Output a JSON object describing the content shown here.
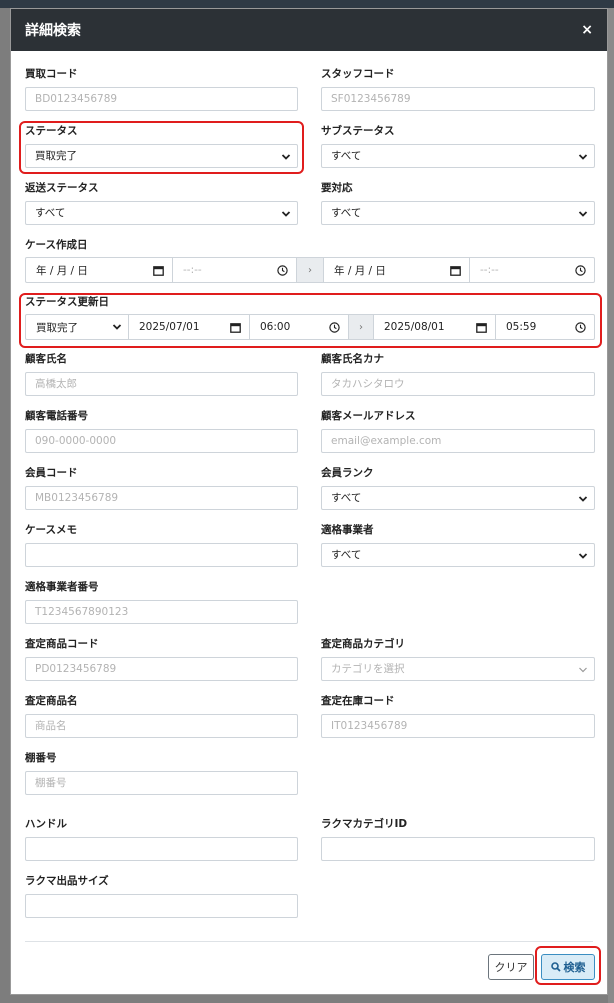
{
  "modal": {
    "title": "詳細検索",
    "close": "×"
  },
  "fields": {
    "purchase_code": {
      "label": "買取コード",
      "placeholder": "BD0123456789"
    },
    "staff_code": {
      "label": "スタッフコード",
      "placeholder": "SF0123456789"
    },
    "status": {
      "label": "ステータス",
      "value": "買取完了"
    },
    "sub_status": {
      "label": "サブステータス",
      "value": "すべて"
    },
    "return_status": {
      "label": "返送ステータス",
      "value": "すべて"
    },
    "action_required": {
      "label": "要対応",
      "value": "すべて"
    },
    "case_created": {
      "label": "ケース作成日",
      "date_from": "年 / 月 / 日",
      "time_from": "--:--",
      "arrow": "›",
      "date_to": "年 / 月 / 日",
      "time_to": "--:--"
    },
    "status_updated": {
      "label": "ステータス更新日",
      "status": "買取完了",
      "date_from": "2025/07/01",
      "time_from": "06:00",
      "arrow": "›",
      "date_to": "2025/08/01",
      "time_to": "05:59"
    },
    "customer_name": {
      "label": "顧客氏名",
      "placeholder": "高橋太郎"
    },
    "customer_kana": {
      "label": "顧客氏名カナ",
      "placeholder": "タカハシタロウ"
    },
    "customer_phone": {
      "label": "顧客電話番号",
      "placeholder": "090-0000-0000"
    },
    "customer_email": {
      "label": "顧客メールアドレス",
      "placeholder": "email@example.com"
    },
    "member_code": {
      "label": "会員コード",
      "placeholder": "MB0123456789"
    },
    "member_rank": {
      "label": "会員ランク",
      "value": "すべて"
    },
    "case_memo": {
      "label": "ケースメモ",
      "placeholder": ""
    },
    "qualified_business": {
      "label": "適格事業者",
      "value": "すべて"
    },
    "qualified_number": {
      "label": "適格事業者番号",
      "placeholder": "T1234567890123"
    },
    "appraisal_code": {
      "label": "査定商品コード",
      "placeholder": "PD0123456789"
    },
    "appraisal_category": {
      "label": "査定商品カテゴリ",
      "placeholder": "カテゴリを選択"
    },
    "appraisal_name": {
      "label": "査定商品名",
      "placeholder": "商品名"
    },
    "appraisal_stock": {
      "label": "査定在庫コード",
      "placeholder": "IT0123456789"
    },
    "shelf_number": {
      "label": "棚番号",
      "placeholder": "棚番号"
    },
    "handle": {
      "label": "ハンドル",
      "placeholder": ""
    },
    "rakuma_category": {
      "label": "ラクマカテゴリID",
      "placeholder": ""
    },
    "rakuma_size": {
      "label": "ラクマ出品サイズ",
      "placeholder": ""
    }
  },
  "buttons": {
    "clear": "クリア",
    "search": "検索"
  },
  "colors": {
    "header": "#2c3136",
    "highlight": "#e01d1d",
    "search_bg": "#d9ecf7",
    "search_text": "#1f5f91"
  }
}
